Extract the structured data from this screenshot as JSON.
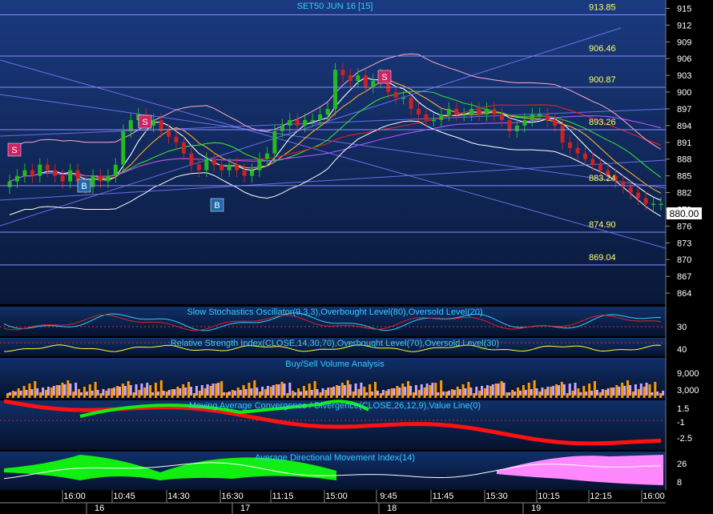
{
  "colors": {
    "panel_bg_top": "#1a3a7a",
    "panel_bg_bottom": "#0a1a3a",
    "grid": "#2f4f8f",
    "label_cyan": "#33ccff",
    "label_yellow": "#ffff66",
    "up_candle": "#22bb22",
    "down_candle": "#cc2222",
    "buy_bar": "#ff9900",
    "sell_bar": "#c8a6ff",
    "macd_band": "#ff1111",
    "macd_pos": "#11ee11",
    "adx_green": "#11ee11",
    "adx_pink": "#ff88ff",
    "fib_line": "#8a8aff",
    "last_price_box": "#ffffff",
    "signal_sell": "#cc2266",
    "signal_buy": "#2266aa"
  },
  "chart_data": [
    {
      "type": "candlestick",
      "title": "SET50 JUN 16   [15]",
      "y_ticks": [
        "915",
        "912",
        "909",
        "906",
        "903",
        "900",
        "897",
        "894",
        "891",
        "888",
        "885",
        "882",
        "879",
        "876",
        "873",
        "870",
        "867",
        "864"
      ],
      "ylim": [
        862,
        916.5
      ],
      "last_price": "880.00",
      "level_lines": [
        {
          "value": 913.85,
          "label": "913.85"
        },
        {
          "value": 906.46,
          "label": "906.46"
        },
        {
          "value": 900.87,
          "label": "900.87"
        },
        {
          "value": 893.26,
          "label": "893.26"
        },
        {
          "value": 883.24,
          "label": "883.24"
        },
        {
          "value": 874.9,
          "label": "874.90"
        },
        {
          "value": 869.04,
          "label": "869.04"
        }
      ],
      "close_series": [
        884,
        885,
        886,
        885,
        887,
        886,
        885,
        884,
        886,
        884,
        883,
        885,
        884,
        885,
        887,
        893,
        895,
        896,
        894,
        895,
        893,
        892,
        891,
        889,
        887,
        886,
        888,
        887,
        886,
        887,
        886,
        885,
        886,
        888,
        889,
        893,
        894,
        895,
        894,
        895,
        895,
        896,
        897,
        904,
        903,
        902,
        903,
        901,
        902,
        903,
        900,
        899,
        899,
        897,
        896,
        895,
        895,
        896,
        897,
        896,
        896,
        897,
        896,
        897,
        896,
        895,
        893,
        894,
        895,
        896,
        896,
        895,
        894,
        891,
        890,
        889,
        888,
        887,
        886,
        885,
        884,
        883,
        882,
        881,
        880,
        880,
        880
      ]
    },
    {
      "type": "line",
      "title": "Slow Stochastics Oscillator(9,3,3),Overbought Level(80),Oversold Level(20)",
      "y_ticks": [
        "30"
      ]
    },
    {
      "type": "line",
      "title": "Relative Strength Index(CLOSE,14,30,70),Overbought Level(70),Oversold Level(30)",
      "y_ticks": [
        "40"
      ]
    },
    {
      "type": "bar",
      "title": "Buy/Sell Volume Analysis",
      "y_ticks": [
        "9,000",
        "3,000"
      ]
    },
    {
      "type": "area",
      "title": "Moving Average Convergence / Divergence(CLOSE,26,12,9),Value Line(0)",
      "y_ticks": [
        "1.5",
        "-1",
        "-2.5"
      ]
    },
    {
      "type": "area",
      "title": "Average Directional Movement Index(14)",
      "y_ticks": [
        "26",
        "8"
      ]
    }
  ],
  "signals": [
    {
      "label": "S",
      "kind": "sell"
    },
    {
      "label": "S",
      "kind": "sell"
    },
    {
      "label": "S",
      "kind": "sell"
    },
    {
      "label": "B",
      "kind": "buy"
    },
    {
      "label": "B",
      "kind": "buy"
    }
  ],
  "x_axis": {
    "time_labels": [
      "16:00",
      "10:45",
      "14:30",
      "16:30",
      "11:15",
      "15:00",
      "9:45",
      "11:45",
      "15:30",
      "10:15",
      "12:15",
      "16:00"
    ],
    "day_labels": [
      "16",
      "17",
      "18",
      "19"
    ]
  }
}
